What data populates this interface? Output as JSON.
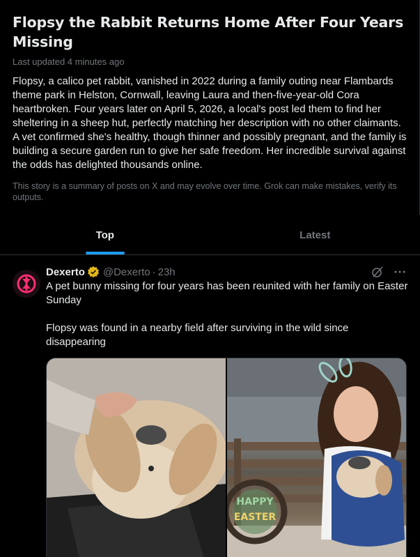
{
  "story": {
    "title": "Flopsy the Rabbit Returns Home After Four Years Missing",
    "updated": "Last updated 4 minutes ago",
    "summary": "Flopsy, a calico pet rabbit, vanished in 2022 during a family outing near Flambards theme park in Helston, Cornwall, leaving Laura and then-five-year-old Cora heartbroken. Four years later on April 5, 2026, a local's post led them to find her sheltering in a sheep hut, perfectly matching her description with no other claimants. A vet confirmed she's healthy, though thinner and possibly pregnant, and the family is building a secure garden run to give her safe freedom. Her incredible survival against the odds has delighted thousands online.",
    "disclaimer": "This story is a summary of posts on X and may evolve over time. Grok can make mistakes, verify its outputs."
  },
  "tabs": [
    {
      "label": "Top",
      "active": true
    },
    {
      "label": "Latest",
      "active": false
    }
  ],
  "post": {
    "author": "Dexerto",
    "handle": "@Dexerto",
    "separator": "·",
    "time": "23h",
    "text": "A pet bunny missing for four years has been reunited with her family on Easter Sunday\n\nFlopsy was found in a nearby field after surviving in the wild since disappearing",
    "photo_sign_text": "HAPPY EASTER"
  },
  "colors": {
    "accent": "#1d9bf0",
    "verified_gold": "#e2b719",
    "avatar_brand": "#ff2e6e",
    "muted": "#71767b",
    "border": "#2f3336"
  }
}
